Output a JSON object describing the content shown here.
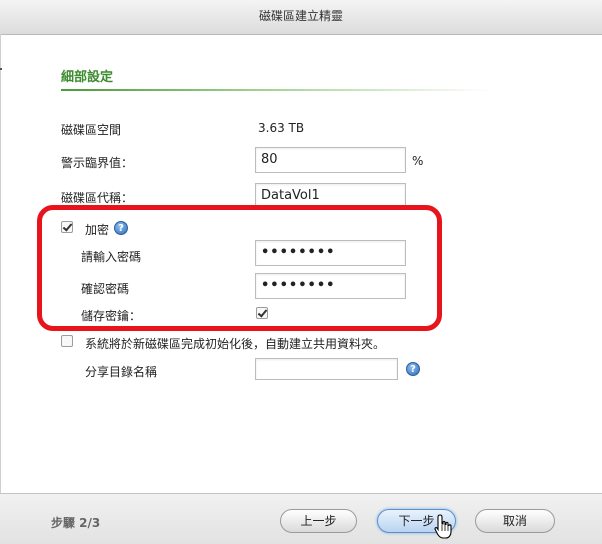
{
  "window": {
    "title": "磁碟區建立精靈"
  },
  "section": {
    "title": "細部設定"
  },
  "fields": {
    "space_label": "磁碟區空間",
    "space_value": "3.63 TB",
    "threshold_label": "警示臨界值：",
    "threshold_value": "80",
    "threshold_unit": "%",
    "alias_label": "磁碟區代稱：",
    "alias_value": "DataVol1"
  },
  "encryption": {
    "label": "加密",
    "checked": true,
    "password_label": "請輸入密碼",
    "password_value": "••••••••",
    "confirm_label": "確認密碼",
    "confirm_value": "••••••••",
    "save_key_label": "儲存密鑰：",
    "save_key_checked": true
  },
  "share": {
    "auto_create_label": "系統將於新磁碟區完成初始化後，自動建立共用資料夾。",
    "auto_create_checked": false,
    "folder_name_label": "分享目錄名稱",
    "folder_name_value": ""
  },
  "footer": {
    "step_text": "步驟 2/3",
    "prev_label": "上一步",
    "next_label": "下一步",
    "cancel_label": "取消"
  },
  "colors": {
    "accent_green": "#3d8a2f",
    "highlight_red": "#e8141b",
    "primary_blue": "#5c8fc7"
  },
  "icons": [
    "help-icon",
    "hand-cursor-icon"
  ]
}
